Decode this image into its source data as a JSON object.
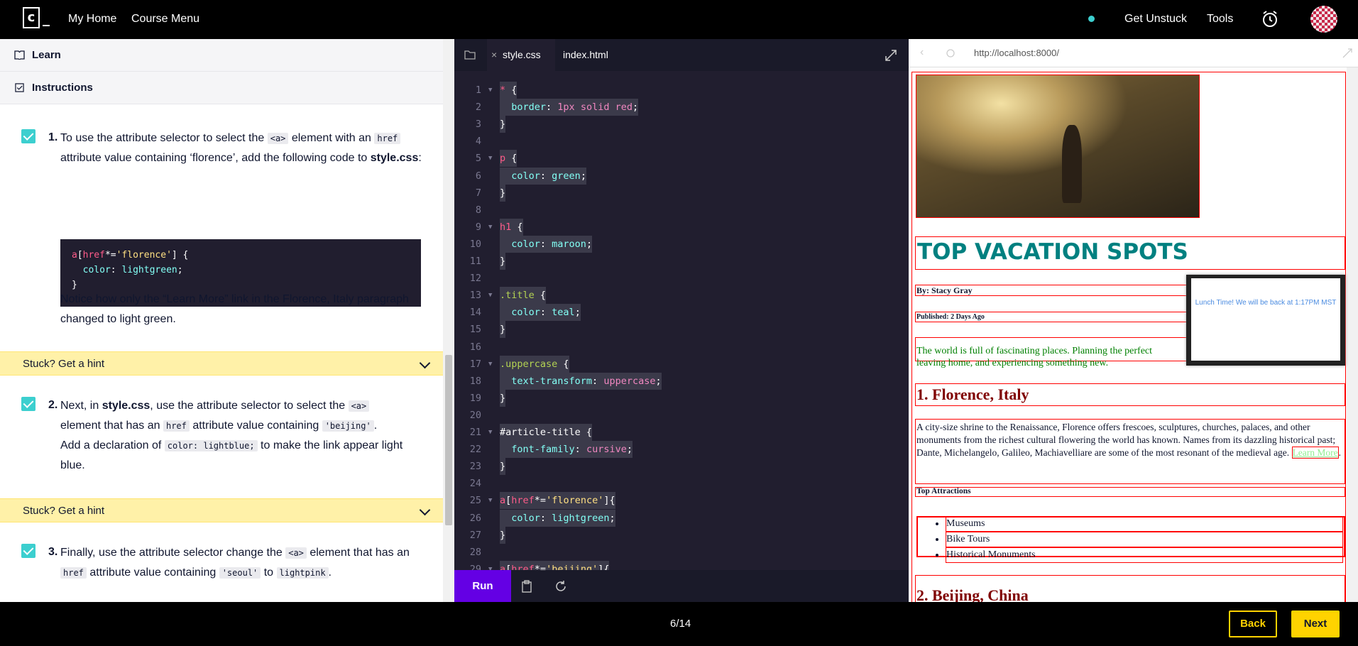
{
  "nav": {
    "logo": "c",
    "my_home": "My Home",
    "course_menu": "Course Menu",
    "get_unstuck": "Get Unstuck",
    "tools": "Tools"
  },
  "left": {
    "learn": "Learn",
    "instructions": "Instructions",
    "steps": [
      {
        "num": "1.",
        "t1": "To use the attribute selector to select the ",
        "c1": "<a>",
        "t2": " element with an",
        "c2": "href",
        "t3": " attribute value containing ‘florence’, add the following code to ",
        "b1": "style.css",
        ":": ":"
      },
      {
        "num": "2.",
        "t1": "Next, in ",
        "b1": "style.css",
        "t2": ", use the attribute selector to select the ",
        "c1": "<a>",
        "t3": "element that has an ",
        "c2": "href",
        "t4": " attribute value containing ",
        "c3": "'beijing'",
        "t5": ".",
        "t6": "Add a declaration of ",
        "c4": "color: lightblue;",
        "t7": " to make the link appear light blue."
      },
      {
        "num": "3.",
        "t1": "Finally, use the attribute selector change the ",
        "c1": "<a>",
        "t2": " element that has an ",
        "c2": "href",
        "t3": " attribute value containing ",
        "c3": "'seoul'",
        "t4": " to ",
        "c4": "lightpink",
        "t5": "."
      }
    ],
    "codeblock": [
      "a[href*='florence'] {",
      "  color: lightgreen;",
      "}"
    ],
    "notice": "Notice how only the “Learn More” link in the Florence, Italy paragraph changed to light green.",
    "hint": "Stuck? Get a hint"
  },
  "editor": {
    "tab1": "style.css",
    "tab2": "index.html",
    "run": "Run"
  },
  "browser": {
    "url": "http://localhost:8000/",
    "title": "TOP VACATION SPOTS",
    "by": "By: Stacy Gray",
    "published": "Published: 2 Days Ago",
    "intro": "The world is full of fascinating places. Planning the perfect",
    "intro2": "leaving home, and experiencing something new.",
    "h_florence": "1. Florence, Italy",
    "florence_text": "A city-size shrine to the Renaissance, Florence offers frescoes, sculptures, churches, palaces, and other monuments from the richest cultural flowering the world has known. Names from its dazzling historical past; Dante, Michelangelo, Galileo, Machiavelliare are some of the most resonant of the medieval age.",
    "learn_more": "Learn More",
    "top_attr": "Top Attractions",
    "attractions": [
      "Museums",
      "Bike Tours",
      "Historical Monuments"
    ],
    "h_beijing": "2. Beijing, China",
    "overlay": "Lunch Time! We will be back at 1:17PM MST"
  },
  "bottom": {
    "progress": "6/14",
    "back": "Back",
    "next": "Next"
  },
  "colors": {
    "accent": "#6400e4",
    "yellow": "#ffd300",
    "teal": "#3ccfcf"
  }
}
